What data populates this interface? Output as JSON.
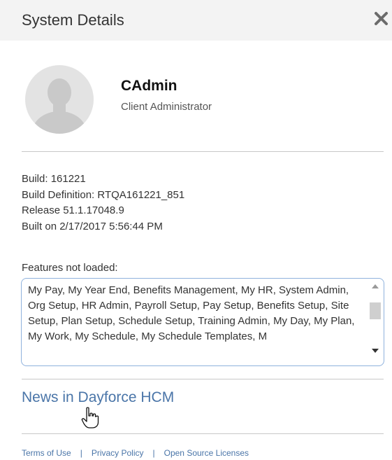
{
  "header": {
    "title": "System Details",
    "close_icon": "close-icon"
  },
  "user": {
    "name": "CAdmin",
    "role": "Client Administrator",
    "avatar_icon": "avatar-placeholder-icon"
  },
  "build": {
    "build": "Build: 161221",
    "definition": "Build Definition: RTQA161221_851",
    "release": "Release 51.1.17048.9",
    "built_on": "Built on 2/17/2017 5:56:44 PM"
  },
  "features": {
    "label": "Features not loaded:",
    "text": "My Pay, My Year End, Benefits Management, My HR, System Admin, Org Setup, HR Admin, Payroll Setup, Pay Setup, Benefits Setup, Site Setup, Plan Setup, Schedule Setup, Training Admin, My Day, My Plan, My Work, My Schedule, My Schedule Templates, M"
  },
  "news": {
    "link": "News in Dayforce HCM"
  },
  "footer": {
    "links": [
      "Terms of Use",
      "Privacy Policy",
      "Open Source Licenses"
    ],
    "separator": "|"
  },
  "colors": {
    "link": "#4a75a8",
    "header_bg": "#f3f3f3",
    "box_border": "#8fb2dd"
  }
}
